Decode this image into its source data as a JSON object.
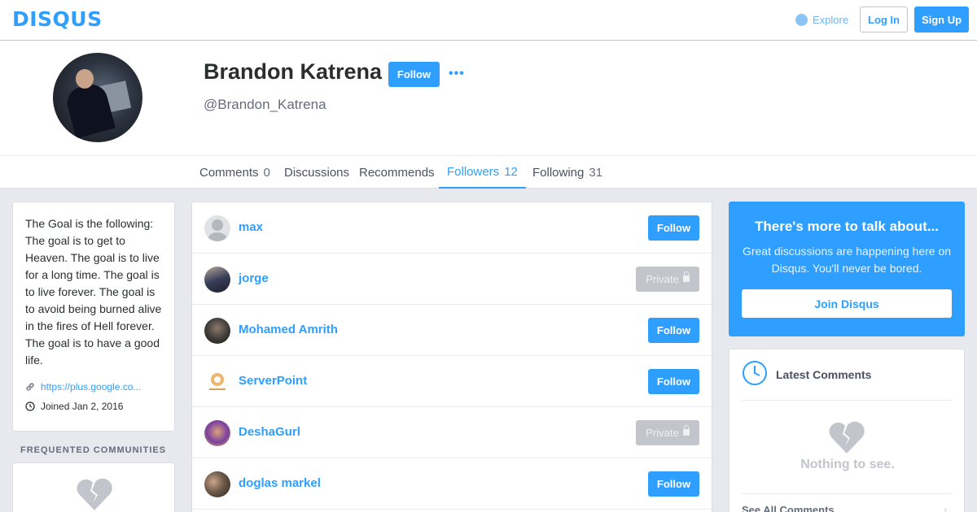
{
  "nav": {
    "logo": "DISQUS",
    "explore": "Explore",
    "login": "Log In",
    "signup": "Sign Up"
  },
  "profile": {
    "name": "Brandon Katrena",
    "handle": "@Brandon_Katrena",
    "follow": "Follow",
    "more": "•••"
  },
  "tabs": [
    {
      "label": "Comments",
      "count": "0"
    },
    {
      "label": "Discussions",
      "count": ""
    },
    {
      "label": "Recommends",
      "count": ""
    },
    {
      "label": "Followers",
      "count": "12"
    },
    {
      "label": "Following",
      "count": "31"
    }
  ],
  "active_tab": "Followers",
  "bio": {
    "text": "The Goal is the following: The goal is to get to Heaven. The goal is to live for a long time. The goal is to live forever. The goal is to avoid being burned alive in the fires of Hell forever. The goal is to have a good life.",
    "link": "https://plus.google.co...",
    "joined": "Joined Jan 2, 2016"
  },
  "frequented": {
    "title": "FREQUENTED COMMUNITIES"
  },
  "followers": [
    {
      "name": "max",
      "button": "Follow",
      "private": false
    },
    {
      "name": "jorge",
      "button": "Private",
      "private": true
    },
    {
      "name": "Mohamed Amrith",
      "button": "Follow",
      "private": false
    },
    {
      "name": "ServerPoint",
      "button": "Follow",
      "private": false
    },
    {
      "name": "DeshaGurl",
      "button": "Private",
      "private": true
    },
    {
      "name": "doglas markel",
      "button": "Follow",
      "private": false
    }
  ],
  "promo": {
    "title": "There's more to talk about...",
    "body": "Great discussions are happening here on Disqus. You'll never be bored.",
    "button": "Join Disqus"
  },
  "latest": {
    "title": "Latest Comments",
    "empty": "Nothing to see.",
    "see_all": "See All Comments"
  },
  "colors": {
    "brand": "#2e9fff",
    "private_button": "#c2c6cc",
    "background": "#e7e9ee"
  },
  "icons": [
    "explore-icon",
    "more-icon",
    "link-icon",
    "clock-icon",
    "broken-heart-icon",
    "lock-icon",
    "chevron-right-icon"
  ]
}
